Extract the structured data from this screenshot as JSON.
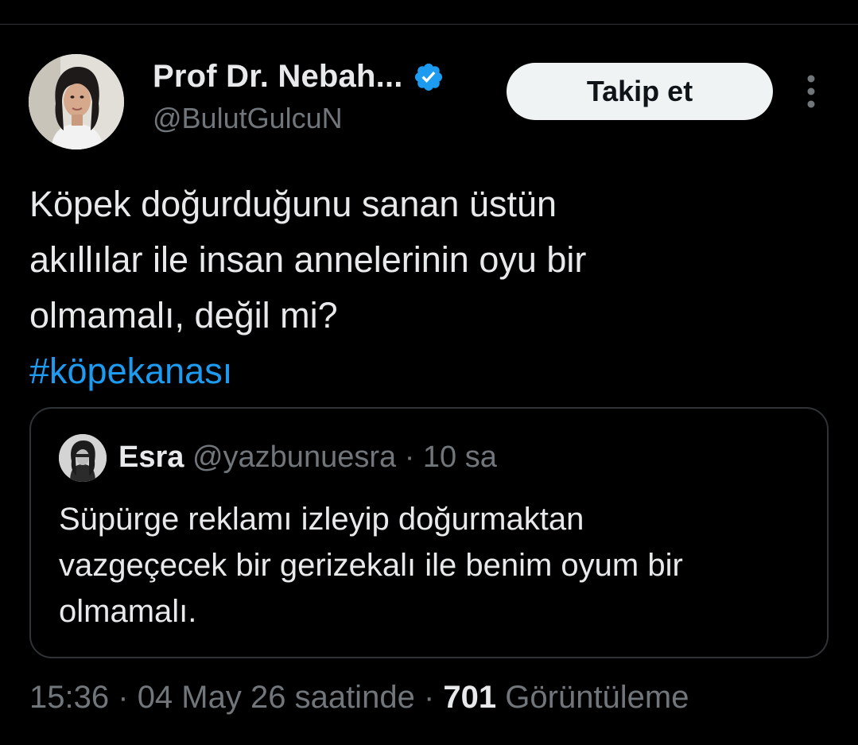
{
  "author": {
    "display_name": "Prof Dr. Nebah...",
    "handle": "@BulutGulcuN",
    "verified_color": "#1d9bf0"
  },
  "actions": {
    "follow_label": "Takip et",
    "more_icon": "more-vertical-icon"
  },
  "tweet": {
    "text_lines": [
      "Köpek doğurduğunu sanan üstün",
      "akıllılar ile insan annelerinin oyu bir",
      "olmamalı, değil mi?"
    ],
    "hashtag": "#köpekanası",
    "hashtag_color": "#1d9bf0"
  },
  "quote": {
    "name": "Esra",
    "handle": "@yazbunuesra",
    "separator": "·",
    "time": "10 sa",
    "text_lines": [
      "Süpürge reklamı izleyip doğurmaktan",
      "vazgeçecek bir gerizekalı ile benim oyum bir",
      "olmamalı."
    ]
  },
  "meta": {
    "time": "15:36",
    "separator": "·",
    "date": "04 May 26 saatinde",
    "views_count": "701",
    "views_label": "Görüntüleme"
  },
  "colors": {
    "background": "#000000",
    "primary_text": "#e7e9ea",
    "secondary_text": "#71767b",
    "border": "#2f3336"
  }
}
